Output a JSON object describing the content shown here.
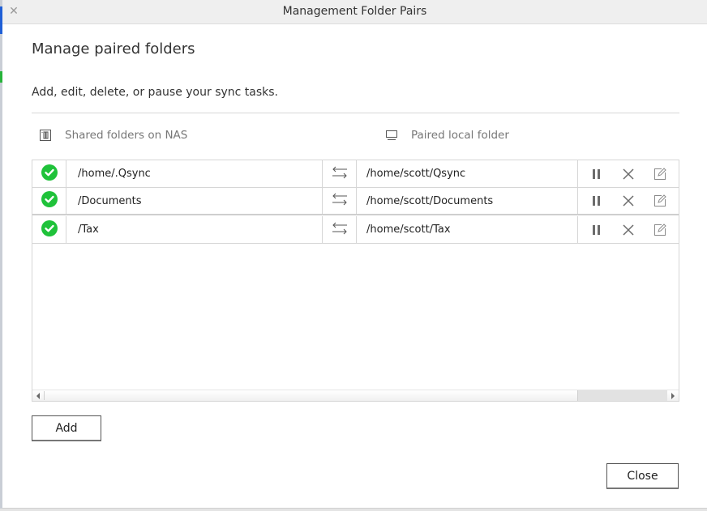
{
  "window": {
    "title": "Management Folder Pairs",
    "close_icon": "close-icon"
  },
  "dialog": {
    "heading": "Manage paired folders",
    "subtitle": "Add, edit, delete, or pause your sync tasks."
  },
  "columns": {
    "nas": {
      "label": "Shared folders on NAS",
      "icon": "nas-icon"
    },
    "local": {
      "label": "Paired local folder",
      "icon": "monitor-icon"
    }
  },
  "pairs": [
    {
      "status": "synced",
      "nas_folder": "/home/.Qsync",
      "local_folder": "/home/scott/Qsync"
    },
    {
      "status": "synced",
      "nas_folder": "/Documents",
      "local_folder": "/home/scott/Documents"
    },
    {
      "status": "synced",
      "nas_folder": "/Tax",
      "local_folder": "/home/scott/Tax"
    }
  ],
  "row_actions": [
    "pause-icon",
    "delete-icon",
    "edit-icon"
  ],
  "buttons": {
    "add": "Add",
    "close": "Close"
  },
  "colors": {
    "status_ok": "#1fc23a",
    "icon_gray": "#6b6b6b"
  }
}
